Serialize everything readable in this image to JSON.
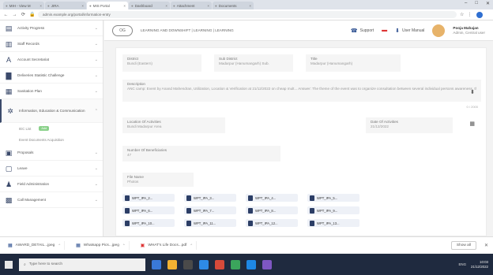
{
  "browser": {
    "tabs": [
      {
        "label": "MIH - View M",
        "active": false
      },
      {
        "label": "JIRA",
        "active": false
      },
      {
        "label": "MIS Portal",
        "active": true
      },
      {
        "label": "Dashboard",
        "active": false
      },
      {
        "label": "Attachment",
        "active": false
      },
      {
        "label": "Documents",
        "active": false
      }
    ],
    "url": "admin.example.org/portal/information-entry",
    "window_controls": [
      "–",
      "□",
      "✕"
    ]
  },
  "sidebar": {
    "items": [
      {
        "label": "Activity Progress",
        "icon": "chart-icon",
        "glyph": "▤"
      },
      {
        "label": "Staff Records",
        "icon": "book-icon",
        "glyph": "▥"
      },
      {
        "label": "Account Secretariat",
        "icon": "letter-a-icon",
        "glyph": "A"
      },
      {
        "label": "Deliveries Statistic Challenge",
        "icon": "bar-chart-icon",
        "glyph": "▇"
      },
      {
        "label": "Sanitation Plan",
        "icon": "chart-box-icon",
        "glyph": "▦"
      }
    ],
    "open_item": {
      "label": "Information, Education & Communication",
      "icon": "network-icon",
      "glyph": "✲"
    },
    "sub_items": [
      {
        "label": "IEC List",
        "badge": "Add"
      },
      {
        "label": "Event Documents Acquisition",
        "badge": ""
      }
    ],
    "items_after": [
      {
        "label": "Proposals",
        "icon": "folder-icon",
        "glyph": "▣"
      },
      {
        "label": "Leave",
        "icon": "page-icon",
        "glyph": "▢"
      },
      {
        "label": "Field Administration",
        "icon": "people-icon",
        "glyph": "♟"
      },
      {
        "label": "Call Management",
        "icon": "monitor-icon",
        "glyph": "▩"
      }
    ]
  },
  "header": {
    "logo_text": "OG",
    "breadcrumb": "LEARNING AND DOWNSHIFT  |  LEARNING  |  LEARNING",
    "support": "Support",
    "user_guide": "User Manual",
    "user_name": "Pooja Mahajan",
    "user_role": "Admin, Central user"
  },
  "form": {
    "district": {
      "label": "District",
      "value": "Bundi (Eastern)"
    },
    "sub_district": {
      "label": "Sub District",
      "value": "Madarpur (Hanumangarh) Sub."
    },
    "title": {
      "label": "Title",
      "value": "Madarpur (Hanumangarh)"
    },
    "description": {
      "label": "Description",
      "value": "ANC camp: Event by Anand Mahendran, Utilization, Location & Verification at 21/12/2022 on cheap mult... Answer: The theme of the event was to organize consultation between several individual persons awareness, the staff dialogues and all relevant plans Bandra. Gathering of everyone and the participants...."
    },
    "char_count": "0 / 2000",
    "location": {
      "label": "Location Of Activities",
      "value": "Bundi Madarpur Area"
    },
    "date": {
      "label": "Date Of Activities",
      "value": "21/12/2022"
    },
    "participants": {
      "label": "Number Of Beneficiaries",
      "value": "47"
    },
    "file_name": {
      "label": "File Name",
      "value": "Photos"
    }
  },
  "attachments": [
    "WPT_IPA_2...",
    "WPT_IPA_3...",
    "WPT_IPA_4...",
    "WPT_IPA_5...",
    "WPT_IPA_6...",
    "WPT_IPA_7...",
    "WPT_IPA_8...",
    "WPT_IPA_9...",
    "WPT_IPA_10...",
    "WPT_IPA_11...",
    "WPT_IPA_12...",
    "WPT_IPA_13..."
  ],
  "downloads": [
    {
      "name": "AWARD_DETAIL...jpeg",
      "icon": "image-file-icon",
      "glyph": "▦",
      "red": false
    },
    {
      "name": "Whatsapp Pics...jpeg",
      "icon": "image-file-icon",
      "glyph": "▦",
      "red": false
    },
    {
      "name": "WHAT's Life Docs...pdf",
      "icon": "pdf-file-icon",
      "glyph": "▣",
      "red": true
    }
  ],
  "show_all": "Show all",
  "taskbar": {
    "search_placeholder": "Type here to search",
    "apps": [
      "#3a79d8",
      "#f2b132",
      "#4a4a4a",
      "#2e8ae6",
      "#d64a3a",
      "#3ba55c",
      "#1e88e5",
      "#7e57c2"
    ],
    "tray_text": "ENG",
    "time": "10:03",
    "date": "21/12/2022"
  },
  "colors": {
    "accent": "#2a4d8f",
    "sidebar_active": "#3b4a6b",
    "taskbar": "#1f2a3f"
  }
}
